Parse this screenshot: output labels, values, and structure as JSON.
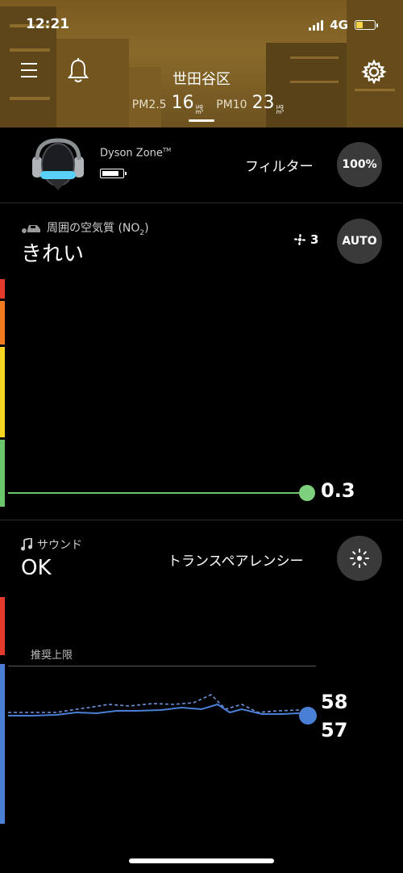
{
  "status_bar": {
    "time": "12:21",
    "network": "4G",
    "battery_color": "#f7d34a"
  },
  "header": {
    "city": "世田谷区",
    "pm25_label": "PM2.5",
    "pm25_value": "16",
    "pm10_label": "PM10",
    "pm10_value": "23",
    "unit_top": "μg",
    "unit_bottom": "m³"
  },
  "device": {
    "name": "Dyson Zone",
    "trademark": "TM",
    "filter_label": "フィルター",
    "filter_value": "100%"
  },
  "air_quality": {
    "label_prefix": "周囲の空気質 (NO",
    "label_sub": "2",
    "label_suffix": ")",
    "status": "きれい",
    "fan_speed": "3",
    "mode_button": "AUTO",
    "value": "0.3",
    "scale_colors": [
      "#e5392b",
      "#f07a1f",
      "#f4d623",
      "#6bc56b"
    ],
    "line_color": "#6bc56b"
  },
  "sound": {
    "label": "サウンド",
    "status": "OK",
    "mode_label": "トランスペアレンシー",
    "recommended_label": "推奨上限",
    "value_1": "58",
    "value_2": "57",
    "scale_colors": [
      "#e5392b",
      "#4a7fd6"
    ]
  }
}
